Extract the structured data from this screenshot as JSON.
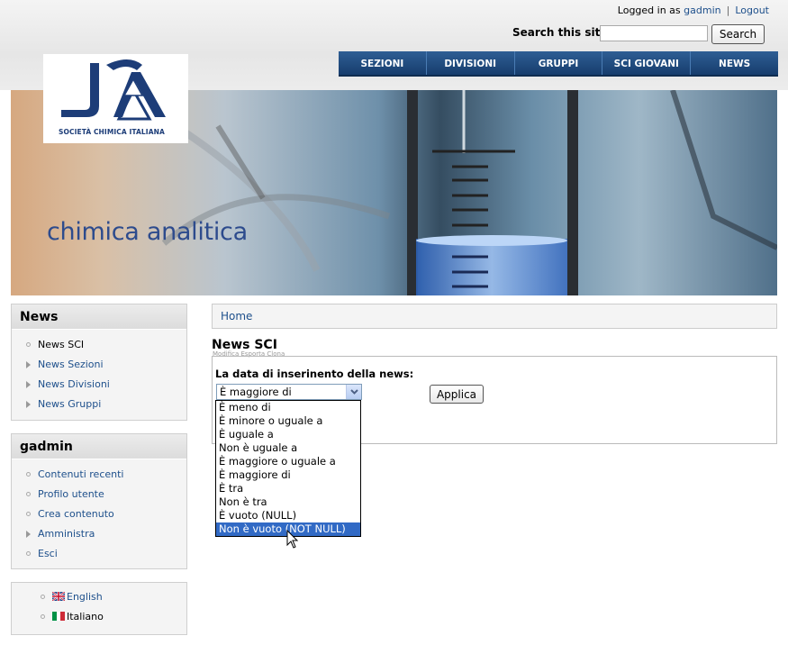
{
  "user": {
    "logged_in_prefix": "Logged in as",
    "username": "gadmin",
    "logout": "Logout"
  },
  "search": {
    "label": "Search this site:",
    "value": "",
    "button": "Search"
  },
  "nav": {
    "items": [
      "SEZIONI",
      "DIVISIONI",
      "GRUPPI",
      "SCI GIOVANI",
      "NEWS"
    ]
  },
  "logo": {
    "text": "SOCIETÀ CHIMICA ITALIANA"
  },
  "banner": {
    "title": "chimica analitica"
  },
  "sidebar": {
    "news": {
      "title": "News",
      "items": [
        "News SCI",
        "News Sezioni",
        "News Divisioni",
        "News Gruppi"
      ]
    },
    "user": {
      "title": "gadmin",
      "items": [
        "Contenuti recenti",
        "Profilo utente",
        "Crea contenuto",
        "Amministra",
        "Esci"
      ]
    },
    "languages": {
      "items": [
        "English",
        "Italiano"
      ]
    }
  },
  "breadcrumb": {
    "home": "Home"
  },
  "page": {
    "title": "News SCI",
    "tabs": "Modifica  Esporta  Clona"
  },
  "filter": {
    "label": "La data di inserinento della news:",
    "selected": "È maggiore di",
    "apply": "Applica",
    "options": [
      "È meno di",
      "È minore o uguale a",
      "È uguale a",
      "Non è uguale a",
      "È maggiore o uguale a",
      "È maggiore di",
      "È tra",
      "Non è tra",
      "È vuoto (NULL)",
      "Non è vuoto (NOT NULL)"
    ],
    "highlighted_index": 9
  },
  "colors": {
    "link": "#1d4f8b",
    "nav_bg": "#1f4a7c",
    "highlight": "#316ac5"
  }
}
